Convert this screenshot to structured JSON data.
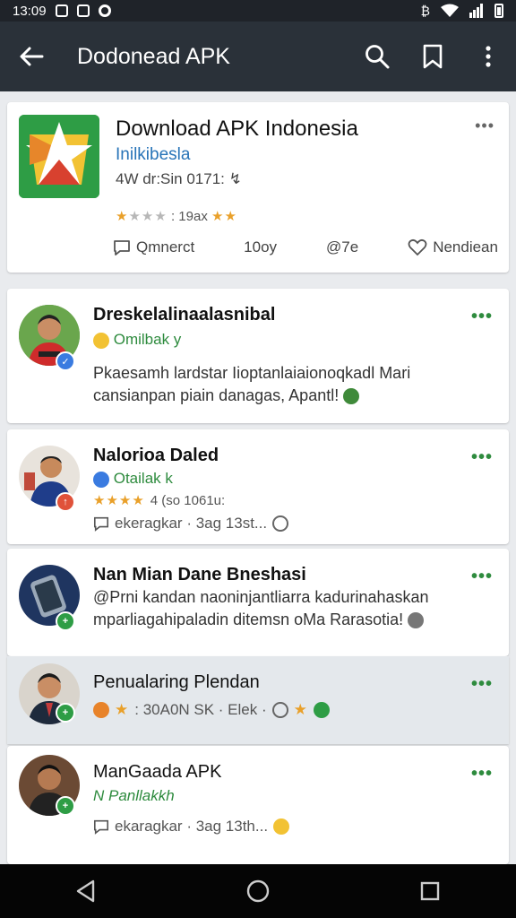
{
  "status": {
    "time": "13:09",
    "carrier": "₿"
  },
  "app_bar": {
    "title": "Dodonead APK",
    "back_icon": "arrow-left-icon",
    "search_icon": "search-icon",
    "bookmark_icon": "bookmark-icon",
    "menu_icon": "more-vert-icon"
  },
  "hero": {
    "title": "Download APK Indonesia",
    "subtitle": "Inilkibesla",
    "meta": "4W dr:Sin 0171: ↯",
    "rating": ": 19ax",
    "more": "•••",
    "comment_label": "Qmnerct",
    "count_label": "10oy",
    "views_label": "@7e",
    "like_label": "Nendiean"
  },
  "posts": [
    {
      "name": "Dreskelalinaalasnibal",
      "sub": "Omilbak y",
      "body": "Pkaesamh lardstar Iioptanlaiaionoqkadl Mari cansianpan piain danagas, Apantl!",
      "more": "•••"
    },
    {
      "name": "Nalorioa Daled",
      "sub": "Otailak k",
      "rating": "4 (so 1061u:",
      "meta": "ekeragkar · 3ag   13st...",
      "more": "•••"
    },
    {
      "name": "Nan Mian Dane Bneshasi",
      "body": "@Prni kandan naoninjantliarra kadurinahaskan mparliagahipaladin ditemsn oMa Rarasotia!",
      "more": "•••"
    },
    {
      "name": "Penualaring Plendan",
      "meta": ": 30A0N SK  ·  Elek ·",
      "more": "•••"
    },
    {
      "name": "ManGaada APK",
      "sub": "N Panllakkh",
      "meta": "ekaragkar · 3ag   13th...",
      "more": "•••"
    }
  ],
  "colors": {
    "app_bar": "#2a3139",
    "status_bar": "#1f2329",
    "accent_green": "#2e8b3e",
    "link_blue": "#2874b8",
    "star": "#e9a02a"
  }
}
